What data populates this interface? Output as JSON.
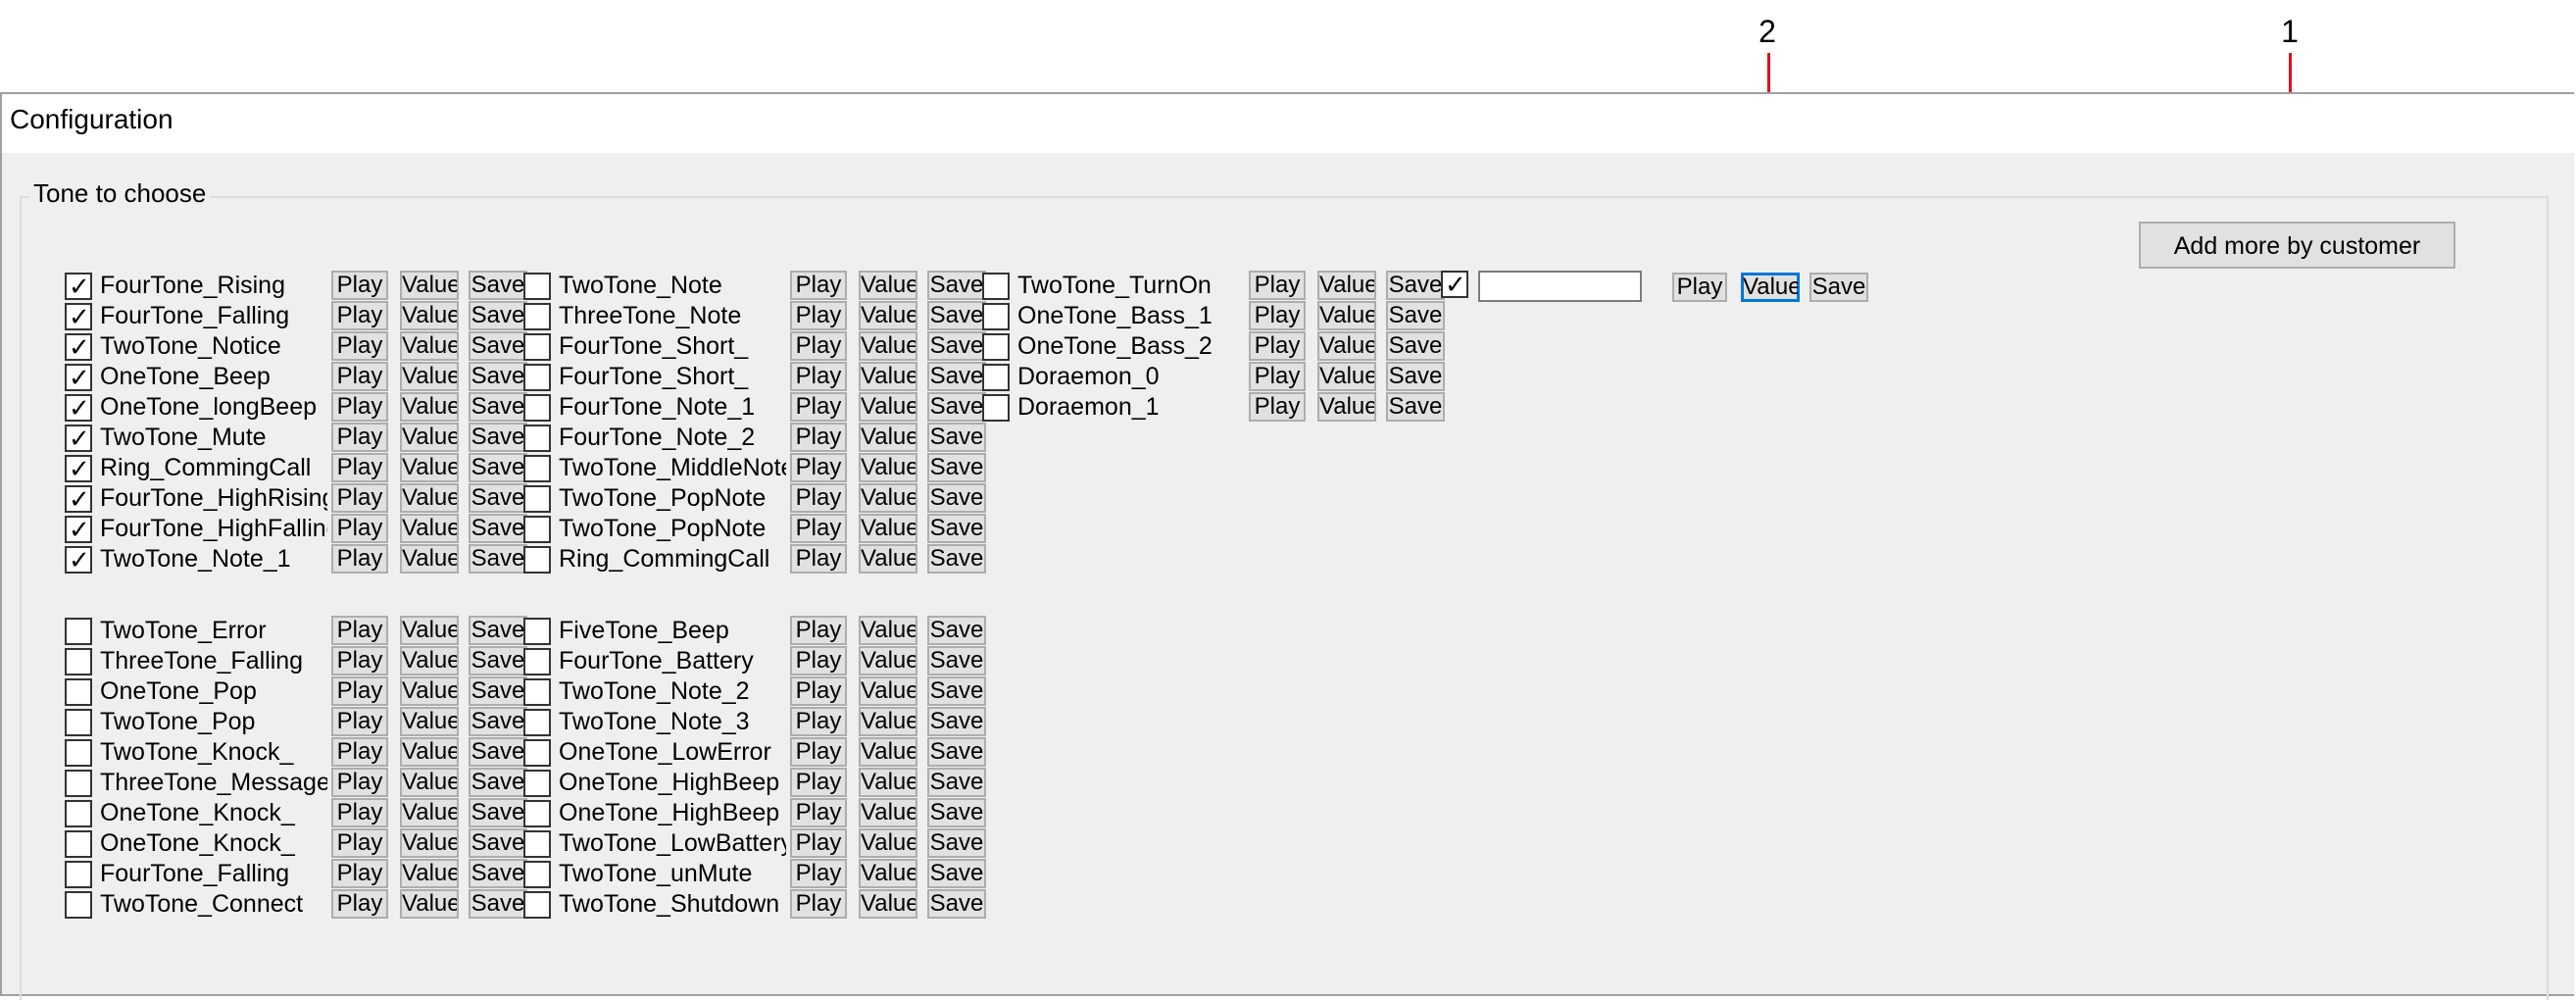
{
  "callouts": {
    "one": "1",
    "two": "2"
  },
  "colors": {
    "callout": "#e2101a",
    "focus": "#0078d7"
  },
  "window": {
    "title": "Configuration"
  },
  "group": {
    "title": "Tone to choose"
  },
  "add_button": {
    "label": "Add more by customer"
  },
  "buttons": {
    "play": "Play",
    "value": "Value",
    "save": "Save"
  },
  "custom_row": {
    "checked": true,
    "input_value": ""
  },
  "columns": [
    {
      "groups": [
        [
          {
            "label": "FourTone_Rising",
            "checked": true
          },
          {
            "label": "FourTone_Falling",
            "checked": true
          },
          {
            "label": "TwoTone_Notice",
            "checked": true
          },
          {
            "label": "OneTone_Beep",
            "checked": true
          },
          {
            "label": "OneTone_longBeep",
            "checked": true
          },
          {
            "label": "TwoTone_Mute",
            "checked": true
          },
          {
            "label": "Ring_CommingCall",
            "checked": true
          },
          {
            "label": "FourTone_HighRising",
            "checked": true
          },
          {
            "label": "FourTone_HighFalling",
            "checked": true
          },
          {
            "label": "TwoTone_Note_1",
            "checked": true
          }
        ],
        [
          {
            "label": "TwoTone_Error",
            "checked": false
          },
          {
            "label": "ThreeTone_Falling",
            "checked": false
          },
          {
            "label": "OneTone_Pop",
            "checked": false
          },
          {
            "label": "TwoTone_Pop",
            "checked": false
          },
          {
            "label": "TwoTone_Knock_",
            "checked": false
          },
          {
            "label": "ThreeTone_Message",
            "checked": false
          },
          {
            "label": "OneTone_Knock_",
            "checked": false
          },
          {
            "label": "OneTone_Knock_",
            "checked": false
          },
          {
            "label": "FourTone_Falling",
            "checked": false
          },
          {
            "label": "TwoTone_Connect",
            "checked": false
          }
        ]
      ]
    },
    {
      "groups": [
        [
          {
            "label": "TwoTone_Note",
            "checked": false
          },
          {
            "label": "ThreeTone_Note",
            "checked": false
          },
          {
            "label": "FourTone_Short_",
            "checked": false
          },
          {
            "label": "FourTone_Short_",
            "checked": false
          },
          {
            "label": "FourTone_Note_1",
            "checked": false
          },
          {
            "label": "FourTone_Note_2",
            "checked": false
          },
          {
            "label": "TwoTone_MiddleNote",
            "checked": false
          },
          {
            "label": "TwoTone_PopNote",
            "checked": false
          },
          {
            "label": "TwoTone_PopNote",
            "checked": false
          },
          {
            "label": "Ring_CommingCall",
            "checked": false
          }
        ],
        [
          {
            "label": "FiveTone_Beep",
            "checked": false
          },
          {
            "label": "FourTone_Battery",
            "checked": false
          },
          {
            "label": "TwoTone_Note_2",
            "checked": false
          },
          {
            "label": "TwoTone_Note_3",
            "checked": false
          },
          {
            "label": "OneTone_LowError",
            "checked": false
          },
          {
            "label": "OneTone_HighBeep",
            "checked": false
          },
          {
            "label": "OneTone_HighBeep",
            "checked": false
          },
          {
            "label": "TwoTone_LowBattery",
            "checked": false
          },
          {
            "label": "TwoTone_unMute",
            "checked": false
          },
          {
            "label": "TwoTone_Shutdown",
            "checked": false
          }
        ]
      ]
    },
    {
      "groups": [
        [
          {
            "label": "TwoTone_TurnOn",
            "checked": false
          },
          {
            "label": "OneTone_Bass_1",
            "checked": false
          },
          {
            "label": "OneTone_Bass_2",
            "checked": false
          },
          {
            "label": "Doraemon_0",
            "checked": false
          },
          {
            "label": "Doraemon_1",
            "checked": false
          }
        ]
      ]
    }
  ]
}
